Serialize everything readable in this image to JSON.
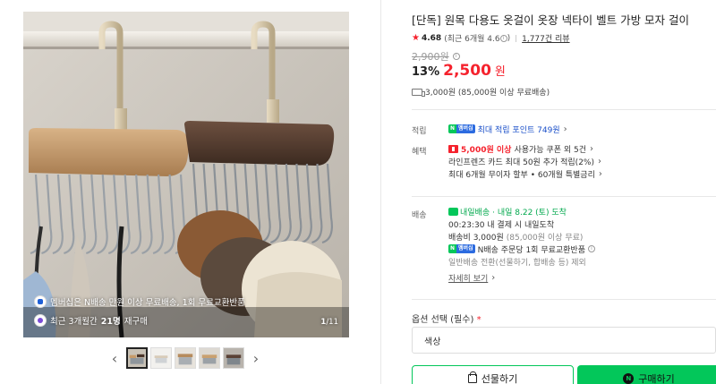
{
  "gallery": {
    "promo_membership": "멤버십은 N배송 만원 이상 무료배송, 1회 무료교환반품",
    "promo_membership_bold": "멤버십은",
    "promo_repurchase_prefix": "최근 3개월간 ",
    "promo_repurchase_bold": "21명",
    "promo_repurchase_suffix": " 재구매",
    "counter_current": "1",
    "counter_total": "/11",
    "prev_arrow": "‹",
    "next_arrow": "›",
    "thumb_count": 5
  },
  "product": {
    "title": "[단독] 원목 다용도 옷걸이 옷장 넥타이 벨트 가방 모자 걸이",
    "rating": "4.68",
    "rating_recent": "(최근 6개월 4.6",
    "rating_recent_close": ")",
    "review_count": "1,777건 리뷰",
    "original_price": "2,900원",
    "discount": "13%",
    "sale_price": "2,500",
    "currency": "원",
    "shipping": "3,000원 (85,000원 이상 무료배송)"
  },
  "points": {
    "label": "적립",
    "badge_n": "N",
    "badge_m": "멤버십",
    "text": "최대 적립 포인트 749원"
  },
  "benefits": {
    "label": "혜택",
    "coupon_bold": "5,000원 이상",
    "coupon_rest": " 사용가능 쿠폰 외 5건",
    "card": "라인프렌즈 카드 최대 50원 추가 적립(2%)",
    "installment": "최대 6개월 무이자 할부 • 60개월 특별금리"
  },
  "delivery": {
    "label": "배송",
    "tomorrow": "내일배송",
    "arrival": " · 내일 8.22 (토) 도착",
    "cutoff": "00:23:30  내 결제 시 내일도착",
    "fee": "배송비 3,000원",
    "fee_note": " (85,000원 이상 무료)",
    "nexchange": "N배송 주문당 1회 무료교환반품",
    "general": "일반배송 전환(선물하기, 합배송 등) 제외",
    "details_link": "자세히 보기"
  },
  "options": {
    "label": "옵션 선택 (필수)",
    "required_mark": "*",
    "select_value": "색상"
  },
  "actions": {
    "gift": "선물하기",
    "buy": "구매하기",
    "buy_icon": "N"
  }
}
